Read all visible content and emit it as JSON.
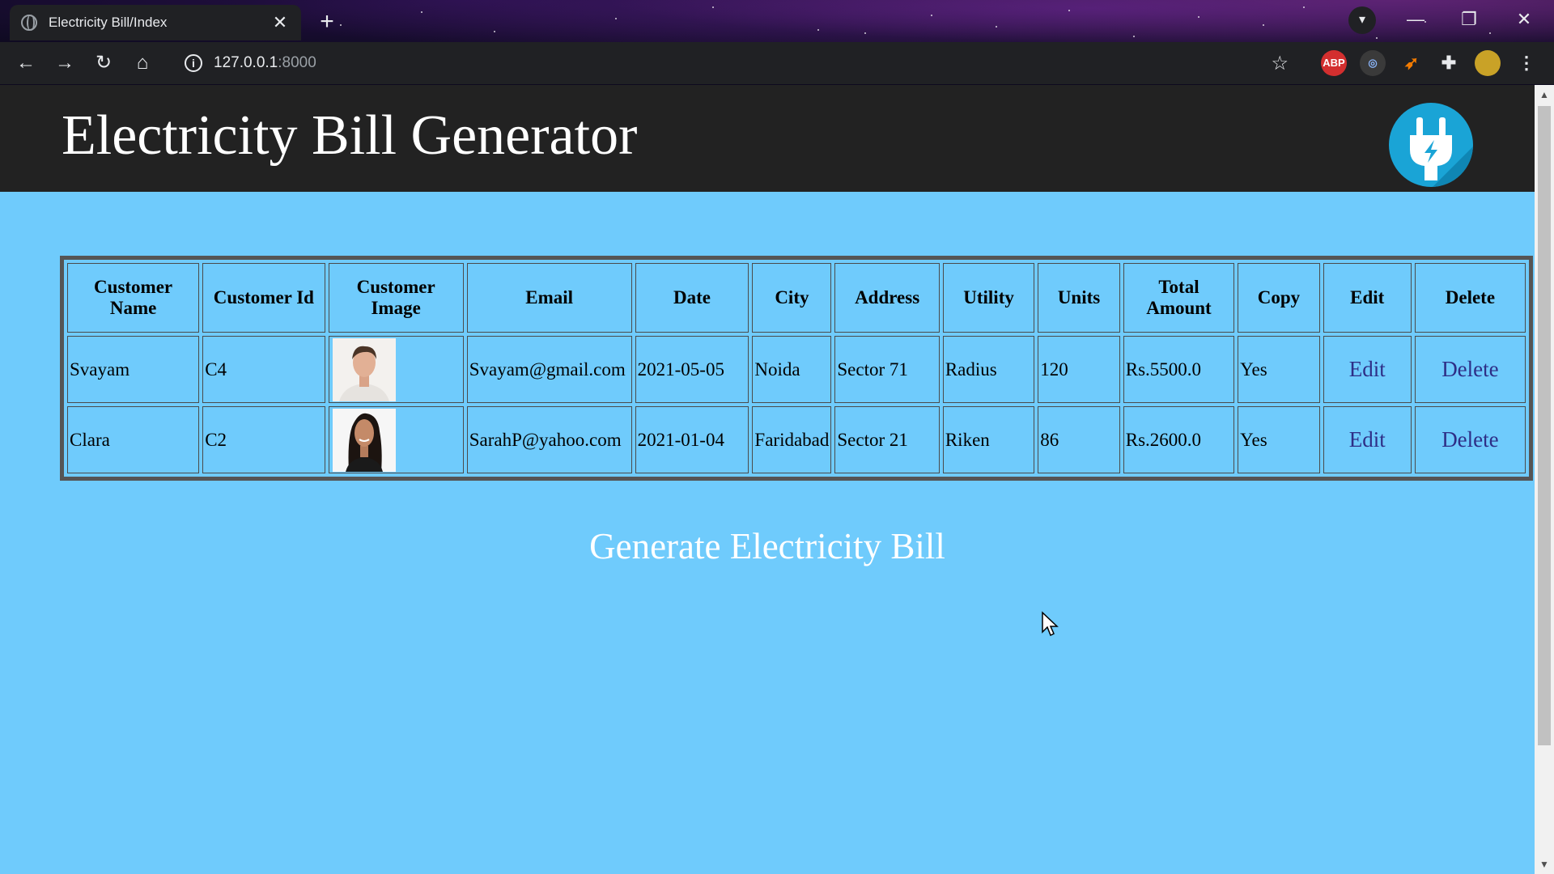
{
  "browser": {
    "tab_title": "Electricity Bill/Index",
    "tab_close": "✕",
    "new_tab": "+",
    "url_host": "127.0.0.1",
    "url_port": ":8000",
    "extensions": [
      "ABP"
    ]
  },
  "header": {
    "title": "Electricity Bill Generator",
    "logo_icon": "plug-lightning-icon"
  },
  "table": {
    "columns": [
      "Customer Name",
      "Customer Id",
      "Customer Image",
      "Email",
      "Date",
      "City",
      "Address",
      "Utility",
      "Units",
      "Total Amount",
      "Copy",
      "Edit",
      "Delete"
    ],
    "rows": [
      {
        "name": "Svayam",
        "id": "C4",
        "image": "male-customer-photo",
        "email": "Svayam@gmail.com",
        "date": "2021-05-05",
        "city": "Noida",
        "address": "Sector 71",
        "utility": "Radius",
        "units": "120",
        "total": "Rs.5500.0",
        "copy": "Yes",
        "edit": "Edit",
        "delete": "Delete"
      },
      {
        "name": "Clara",
        "id": "C2",
        "image": "female-customer-photo",
        "email": "SarahP@yahoo.com",
        "date": "2021-01-04",
        "city": "Faridabad",
        "address": "Sector 21",
        "utility": "Riken",
        "units": "86",
        "total": "Rs.2600.0",
        "copy": "Yes",
        "edit": "Edit",
        "delete": "Delete"
      }
    ]
  },
  "generate_link": "Generate Electricity Bill",
  "colors": {
    "page_bg": "#6fcbfc",
    "header_bg": "#222222",
    "link": "#2e2e86",
    "logo": "#1aa4d6"
  }
}
